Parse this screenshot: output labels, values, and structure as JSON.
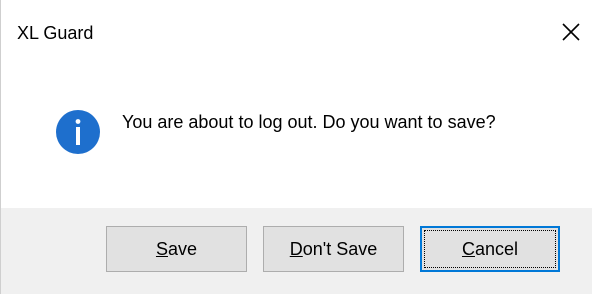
{
  "window": {
    "title": "XL Guard",
    "close_icon": "close-icon"
  },
  "message": {
    "icon": "info-icon",
    "icon_color": "#1e6fcd",
    "text": "You are about to log out. Do you want to save?"
  },
  "buttons": {
    "save": {
      "mnemonic": "S",
      "rest": "ave"
    },
    "dont_save": {
      "mnemonic": "D",
      "rest": "on't Save"
    },
    "cancel": {
      "mnemonic": "C",
      "rest": "ancel"
    }
  },
  "colors": {
    "focus_border": "#0078d7",
    "footer_bg": "#f0f0f0",
    "button_bg": "#e1e1e1"
  }
}
